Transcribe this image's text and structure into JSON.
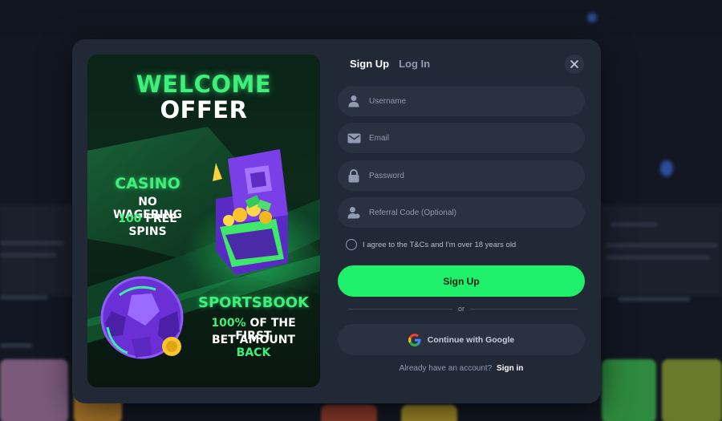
{
  "promo": {
    "welcome_line1": "WELCOME",
    "welcome_line2": "OFFER",
    "casino_title": "CASINO",
    "casino_line2": "NO WAGERING",
    "casino_line3_number": "100",
    "casino_line3_text": "FREE SPINS",
    "sports_title": "SPORTSBOOK",
    "sports_line2_highlight": "100%",
    "sports_line2_text": "OF THE FIRST",
    "sports_line3_text": "BET AMOUNT",
    "sports_line3_highlight": "BACK"
  },
  "tabs": [
    {
      "label": "Sign Up",
      "active": true
    },
    {
      "label": "Log In",
      "active": false
    }
  ],
  "fields": {
    "username": {
      "placeholder": "Username",
      "icon": "user-icon"
    },
    "email": {
      "placeholder": "Email",
      "icon": "email-icon"
    },
    "password": {
      "placeholder": "Password",
      "icon": "lock-icon"
    },
    "referral": {
      "placeholder": "Referral Code (Optional)",
      "icon": "referral-user-icon"
    }
  },
  "terms": {
    "label": "I agree to the T&Cs and I'm over 18 years old",
    "checked": false
  },
  "signup_button": "Sign Up",
  "divider_text": "or",
  "google_button": "Continue with Google",
  "account": {
    "text": "Already have an account?",
    "link": "Sign in"
  },
  "colors": {
    "accent": "#1ef06a",
    "modal_bg": "#222936",
    "field_bg": "#2a3140"
  }
}
